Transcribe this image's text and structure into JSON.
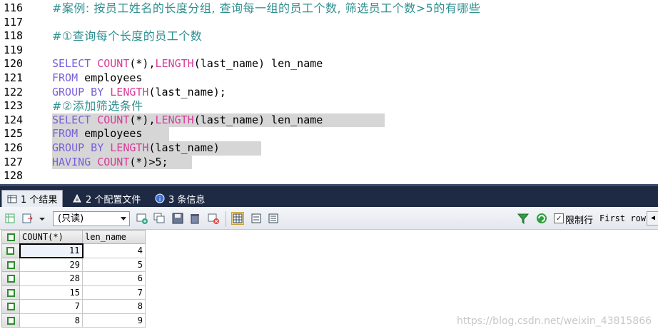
{
  "editor": {
    "lines": [
      {
        "n": "116",
        "tokens": [
          {
            "t": "#案例: 按员工姓名的长度分组, 查询每一组的员工个数, 筛选员工个数>5的有哪些",
            "c": "cm"
          }
        ]
      },
      {
        "n": "117",
        "tokens": []
      },
      {
        "n": "118",
        "tokens": [
          {
            "t": "#①查询每个长度的员工个数",
            "c": "cm"
          }
        ]
      },
      {
        "n": "119",
        "tokens": []
      },
      {
        "n": "120",
        "tokens": [
          {
            "t": "SELECT ",
            "c": "kw"
          },
          {
            "t": "COUNT",
            "c": "fn"
          },
          {
            "t": "(*),",
            "c": "pl"
          },
          {
            "t": "LENGTH",
            "c": "fn"
          },
          {
            "t": "(last_name) len_name",
            "c": "pl"
          }
        ]
      },
      {
        "n": "121",
        "tokens": [
          {
            "t": "FROM ",
            "c": "kw"
          },
          {
            "t": "employees",
            "c": "pl"
          }
        ]
      },
      {
        "n": "122",
        "tokens": [
          {
            "t": "GROUP BY ",
            "c": "kw"
          },
          {
            "t": "LENGTH",
            "c": "fn"
          },
          {
            "t": "(last_name);",
            "c": "pl"
          }
        ]
      },
      {
        "n": "123",
        "tokens": [
          {
            "t": "#②添加筛选条件",
            "c": "cm"
          }
        ]
      },
      {
        "n": "124",
        "hl": "w1",
        "tokens": [
          {
            "t": "SELECT ",
            "c": "kw"
          },
          {
            "t": "COUNT",
            "c": "fn"
          },
          {
            "t": "(*),",
            "c": "pl"
          },
          {
            "t": "LENGTH",
            "c": "fn"
          },
          {
            "t": "(last_name) len_name",
            "c": "pl"
          }
        ]
      },
      {
        "n": "125",
        "hl": "w2",
        "tokens": [
          {
            "t": "FROM ",
            "c": "kw"
          },
          {
            "t": "employees",
            "c": "pl"
          }
        ]
      },
      {
        "n": "126",
        "hl": "w3",
        "tokens": [
          {
            "t": "GROUP BY ",
            "c": "kw"
          },
          {
            "t": "LENGTH",
            "c": "fn"
          },
          {
            "t": "(last_name)",
            "c": "pl"
          }
        ]
      },
      {
        "n": "127",
        "hl": "w4",
        "tokens": [
          {
            "t": "HAVING ",
            "c": "kw"
          },
          {
            "t": "COUNT",
            "c": "fn"
          },
          {
            "t": "(*)>5;",
            "c": "pl"
          }
        ]
      },
      {
        "n": "128",
        "tokens": []
      }
    ]
  },
  "tabs": [
    {
      "label": "1 个结果",
      "icon": "result-grid-icon",
      "active": true
    },
    {
      "label": "2 个配置文件",
      "icon": "profile-icon",
      "active": false
    },
    {
      "label": "3 条信息",
      "icon": "info-icon",
      "active": false
    }
  ],
  "toolbar": {
    "mode_select": "(只读)",
    "limit_label": "限制行",
    "limit_checked": "✓",
    "first_row_label": "First row"
  },
  "grid": {
    "columns": [
      "COUNT(*)",
      "len_name"
    ],
    "rows": [
      [
        "11",
        "4"
      ],
      [
        "29",
        "5"
      ],
      [
        "28",
        "6"
      ],
      [
        "15",
        "7"
      ],
      [
        "7",
        "8"
      ],
      [
        "8",
        "9"
      ]
    ]
  },
  "watermark": "https://blog.csdn.net/weixin_43815866",
  "colors": {
    "keyword": "#7a60d8",
    "function": "#d83a99",
    "comment": "#2f8f8f",
    "tabbar": "#1e2a44"
  }
}
